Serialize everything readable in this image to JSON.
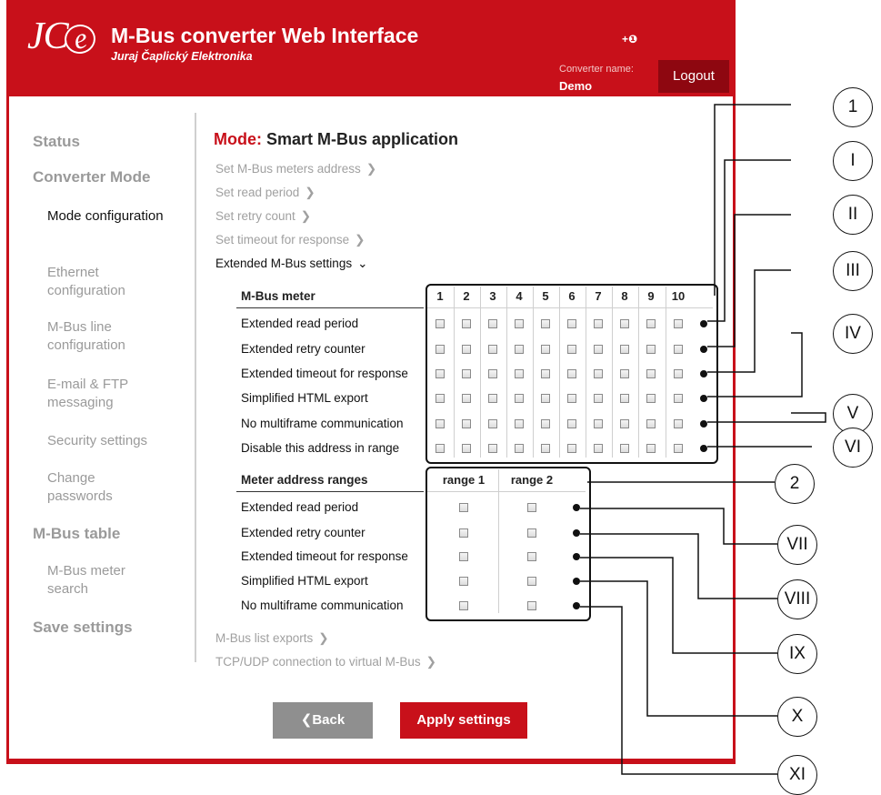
{
  "header": {
    "logo_text": "JC-e",
    "title": "M-Bus converter Web Interface",
    "company": "Juraj Čaplický Elektronika",
    "lang_icon": "+❶",
    "converter_name_label": "Converter name:",
    "converter_name": "Demo",
    "logout_label": "Logout"
  },
  "sidebar": {
    "items": [
      {
        "label": "Status"
      },
      {
        "label": "Converter Mode"
      },
      {
        "label": "Mode configuration"
      },
      {
        "label": "Ethernet configuration"
      },
      {
        "label": "M-Bus line configuration"
      },
      {
        "label": "E-mail & FTP messaging"
      },
      {
        "label": "Security settings"
      },
      {
        "label": "Change passwords"
      },
      {
        "label": "M-Bus table"
      },
      {
        "label": "M-Bus meter search"
      },
      {
        "label": "Save settings"
      }
    ]
  },
  "main": {
    "mode_prefix": "Mode:",
    "mode_value": "Smart M-Bus application",
    "links": [
      "Set M-Bus meters address",
      "Set read period",
      "Set retry count",
      "Set timeout for response"
    ],
    "extended_label": "Extended M-Bus settings",
    "meter_header": "M-Bus meter",
    "meter_columns": [
      "1",
      "2",
      "3",
      "4",
      "5",
      "6",
      "7",
      "8",
      "9",
      "10"
    ],
    "meter_rows": [
      "Extended read period",
      "Extended retry counter",
      "Extended timeout for response",
      "Simplified HTML export",
      "No multiframe communication",
      "Disable this address in range"
    ],
    "range_header": "Meter address ranges",
    "range_columns": [
      "range 1",
      "range 2"
    ],
    "range_rows": [
      "Extended read period",
      "Extended retry counter",
      "Extended timeout for response",
      "Simplified HTML export",
      "No multiframe communication"
    ],
    "bottom_links": [
      "M-Bus list exports",
      "TCP/UDP connection to virtual M-Bus"
    ],
    "back_label": "❮Back",
    "apply_label": "Apply settings"
  },
  "callouts": [
    "1",
    "I",
    "II",
    "III",
    "IV",
    "V",
    "VI",
    "2",
    "VII",
    "VIII",
    "IX",
    "X",
    "XI"
  ]
}
